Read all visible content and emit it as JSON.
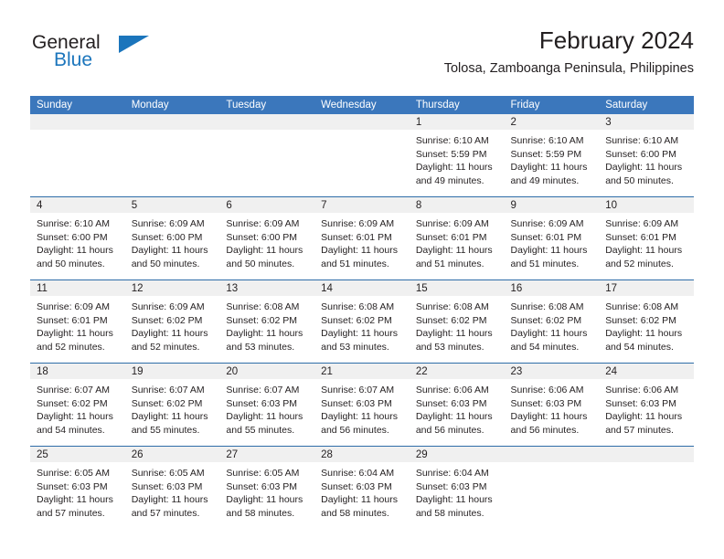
{
  "brand": {
    "name_top": "General",
    "name_bottom": "Blue",
    "color_primary": "#1b75bc",
    "color_text": "#231f20"
  },
  "header": {
    "title": "February 2024",
    "subtitle": "Tolosa, Zamboanga Peninsula, Philippines",
    "accent_color": "#3b77bc"
  },
  "calendar": {
    "weekday_headers": [
      "Sunday",
      "Monday",
      "Tuesday",
      "Wednesday",
      "Thursday",
      "Friday",
      "Saturday"
    ],
    "weeks": [
      [
        {
          "day": "",
          "blank": true
        },
        {
          "day": "",
          "blank": true
        },
        {
          "day": "",
          "blank": true
        },
        {
          "day": "",
          "blank": true
        },
        {
          "day": "1",
          "sunrise": "Sunrise: 6:10 AM",
          "sunset": "Sunset: 5:59 PM",
          "daylight_1": "Daylight: 11 hours",
          "daylight_2": "and 49 minutes."
        },
        {
          "day": "2",
          "sunrise": "Sunrise: 6:10 AM",
          "sunset": "Sunset: 5:59 PM",
          "daylight_1": "Daylight: 11 hours",
          "daylight_2": "and 49 minutes."
        },
        {
          "day": "3",
          "sunrise": "Sunrise: 6:10 AM",
          "sunset": "Sunset: 6:00 PM",
          "daylight_1": "Daylight: 11 hours",
          "daylight_2": "and 50 minutes."
        }
      ],
      [
        {
          "day": "4",
          "sunrise": "Sunrise: 6:10 AM",
          "sunset": "Sunset: 6:00 PM",
          "daylight_1": "Daylight: 11 hours",
          "daylight_2": "and 50 minutes."
        },
        {
          "day": "5",
          "sunrise": "Sunrise: 6:09 AM",
          "sunset": "Sunset: 6:00 PM",
          "daylight_1": "Daylight: 11 hours",
          "daylight_2": "and 50 minutes."
        },
        {
          "day": "6",
          "sunrise": "Sunrise: 6:09 AM",
          "sunset": "Sunset: 6:00 PM",
          "daylight_1": "Daylight: 11 hours",
          "daylight_2": "and 50 minutes."
        },
        {
          "day": "7",
          "sunrise": "Sunrise: 6:09 AM",
          "sunset": "Sunset: 6:01 PM",
          "daylight_1": "Daylight: 11 hours",
          "daylight_2": "and 51 minutes."
        },
        {
          "day": "8",
          "sunrise": "Sunrise: 6:09 AM",
          "sunset": "Sunset: 6:01 PM",
          "daylight_1": "Daylight: 11 hours",
          "daylight_2": "and 51 minutes."
        },
        {
          "day": "9",
          "sunrise": "Sunrise: 6:09 AM",
          "sunset": "Sunset: 6:01 PM",
          "daylight_1": "Daylight: 11 hours",
          "daylight_2": "and 51 minutes."
        },
        {
          "day": "10",
          "sunrise": "Sunrise: 6:09 AM",
          "sunset": "Sunset: 6:01 PM",
          "daylight_1": "Daylight: 11 hours",
          "daylight_2": "and 52 minutes."
        }
      ],
      [
        {
          "day": "11",
          "sunrise": "Sunrise: 6:09 AM",
          "sunset": "Sunset: 6:01 PM",
          "daylight_1": "Daylight: 11 hours",
          "daylight_2": "and 52 minutes."
        },
        {
          "day": "12",
          "sunrise": "Sunrise: 6:09 AM",
          "sunset": "Sunset: 6:02 PM",
          "daylight_1": "Daylight: 11 hours",
          "daylight_2": "and 52 minutes."
        },
        {
          "day": "13",
          "sunrise": "Sunrise: 6:08 AM",
          "sunset": "Sunset: 6:02 PM",
          "daylight_1": "Daylight: 11 hours",
          "daylight_2": "and 53 minutes."
        },
        {
          "day": "14",
          "sunrise": "Sunrise: 6:08 AM",
          "sunset": "Sunset: 6:02 PM",
          "daylight_1": "Daylight: 11 hours",
          "daylight_2": "and 53 minutes."
        },
        {
          "day": "15",
          "sunrise": "Sunrise: 6:08 AM",
          "sunset": "Sunset: 6:02 PM",
          "daylight_1": "Daylight: 11 hours",
          "daylight_2": "and 53 minutes."
        },
        {
          "day": "16",
          "sunrise": "Sunrise: 6:08 AM",
          "sunset": "Sunset: 6:02 PM",
          "daylight_1": "Daylight: 11 hours",
          "daylight_2": "and 54 minutes."
        },
        {
          "day": "17",
          "sunrise": "Sunrise: 6:08 AM",
          "sunset": "Sunset: 6:02 PM",
          "daylight_1": "Daylight: 11 hours",
          "daylight_2": "and 54 minutes."
        }
      ],
      [
        {
          "day": "18",
          "sunrise": "Sunrise: 6:07 AM",
          "sunset": "Sunset: 6:02 PM",
          "daylight_1": "Daylight: 11 hours",
          "daylight_2": "and 54 minutes."
        },
        {
          "day": "19",
          "sunrise": "Sunrise: 6:07 AM",
          "sunset": "Sunset: 6:02 PM",
          "daylight_1": "Daylight: 11 hours",
          "daylight_2": "and 55 minutes."
        },
        {
          "day": "20",
          "sunrise": "Sunrise: 6:07 AM",
          "sunset": "Sunset: 6:03 PM",
          "daylight_1": "Daylight: 11 hours",
          "daylight_2": "and 55 minutes."
        },
        {
          "day": "21",
          "sunrise": "Sunrise: 6:07 AM",
          "sunset": "Sunset: 6:03 PM",
          "daylight_1": "Daylight: 11 hours",
          "daylight_2": "and 56 minutes."
        },
        {
          "day": "22",
          "sunrise": "Sunrise: 6:06 AM",
          "sunset": "Sunset: 6:03 PM",
          "daylight_1": "Daylight: 11 hours",
          "daylight_2": "and 56 minutes."
        },
        {
          "day": "23",
          "sunrise": "Sunrise: 6:06 AM",
          "sunset": "Sunset: 6:03 PM",
          "daylight_1": "Daylight: 11 hours",
          "daylight_2": "and 56 minutes."
        },
        {
          "day": "24",
          "sunrise": "Sunrise: 6:06 AM",
          "sunset": "Sunset: 6:03 PM",
          "daylight_1": "Daylight: 11 hours",
          "daylight_2": "and 57 minutes."
        }
      ],
      [
        {
          "day": "25",
          "sunrise": "Sunrise: 6:05 AM",
          "sunset": "Sunset: 6:03 PM",
          "daylight_1": "Daylight: 11 hours",
          "daylight_2": "and 57 minutes."
        },
        {
          "day": "26",
          "sunrise": "Sunrise: 6:05 AM",
          "sunset": "Sunset: 6:03 PM",
          "daylight_1": "Daylight: 11 hours",
          "daylight_2": "and 57 minutes."
        },
        {
          "day": "27",
          "sunrise": "Sunrise: 6:05 AM",
          "sunset": "Sunset: 6:03 PM",
          "daylight_1": "Daylight: 11 hours",
          "daylight_2": "and 58 minutes."
        },
        {
          "day": "28",
          "sunrise": "Sunrise: 6:04 AM",
          "sunset": "Sunset: 6:03 PM",
          "daylight_1": "Daylight: 11 hours",
          "daylight_2": "and 58 minutes."
        },
        {
          "day": "29",
          "sunrise": "Sunrise: 6:04 AM",
          "sunset": "Sunset: 6:03 PM",
          "daylight_1": "Daylight: 11 hours",
          "daylight_2": "and 58 minutes."
        },
        {
          "day": "",
          "blank": true
        },
        {
          "day": "",
          "blank": true
        }
      ]
    ]
  }
}
